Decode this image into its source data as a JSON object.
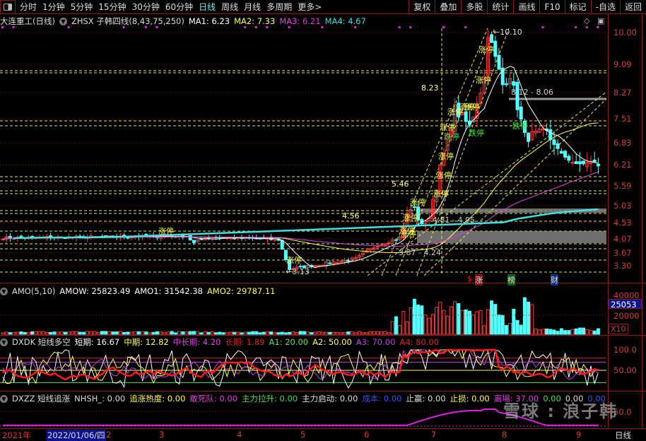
{
  "toolbar": {
    "periods": [
      "分时",
      "1分钟",
      "5分钟",
      "15分钟",
      "30分钟",
      "60分钟",
      "日线",
      "周线",
      "月线",
      "多周期",
      "更多>"
    ],
    "active_period": "日线",
    "buttons": [
      "复权",
      "叠加",
      "多股",
      "统计",
      "画线",
      "F10",
      "标记",
      "-自选",
      "返回"
    ]
  },
  "main": {
    "stock": "大连重工(日线)",
    "indicator": "ZHSX 子韩四线(8,43,75,250)",
    "ma1": "MA1: 6.23",
    "ma2": "MA2: 7.33",
    "ma3": "MA3: 6.21",
    "ma4": "MA4: 4.67",
    "price_ticks": [
      "10.00",
      "9.09",
      "8.27",
      "7.51",
      "6.83",
      "6.21",
      "5.59",
      "5.03",
      "4.53",
      "4.07",
      "3.67",
      "3.30"
    ],
    "annotations": {
      "high": "10.10",
      "low": "3.13",
      "l823": "8.23",
      "l546": "5.46",
      "l456": "4.56",
      "r812": "8.12 - 8.06",
      "r481": "4.81 - 4.95",
      "r387": "3.87 - 4.24",
      "limit_up": "涨停",
      "limit_down": "跌停",
      "m1": "$",
      "m2": "涨",
      "m3": "榜",
      "m4": "财"
    }
  },
  "amo": {
    "title": "AMO(5,10)",
    "amow": "AMOW: 25823.49",
    "amo1": "AMO1: 31542.38",
    "amo2": "AMO2: 29787.11",
    "ticks": [
      "40000",
      "20000"
    ],
    "current": "25053",
    "scale": "X10"
  },
  "dxdk": {
    "title": "DXDK 短线多空",
    "short": "短期: 16.67",
    "mid": "中期: 12.82",
    "midlong": "中长期: 4.20",
    "long": "长期: 1.89",
    "a1": "A1: 20.00",
    "a2": "A2: 50.00",
    "a3": "A3: 70.00",
    "a4": "A4: 80.00",
    "ticks": [
      "100.0",
      "50.00"
    ]
  },
  "dxzz": {
    "title": "DXZZ 短线追涨",
    "items": [
      "NHSH_: 0.00",
      "追涨热度: 0.00",
      "敢死队: 0.00",
      "主力拉升: 0.00",
      "主力启动: 0.00",
      "成本: 0.00",
      "止赢: 0.00",
      "止损: 0.00",
      "离場: 37.00",
      "0.00",
      "0.00",
      "0.00"
    ],
    "tick": "50.0"
  },
  "timeaxis": {
    "year": "2021年",
    "cursor": "2022/01/06/四",
    "months": [
      "1",
      "2",
      "3",
      "4",
      "5",
      "6",
      "7",
      "8",
      "9"
    ],
    "period": "日线"
  },
  "watermark": "雪球 : 浪子韩",
  "colors": {
    "up": "#ff3b3b",
    "down": "#54ffff",
    "ma1": "#ffffff",
    "ma2": "#ffff55",
    "ma3": "#e040e0",
    "ma4": "#40e0e0",
    "axis": "#d83c3c"
  },
  "chart_data": {
    "type": "candlestick",
    "price_keypoints": [
      [
        0,
        4.1
      ],
      [
        50,
        4.15
      ],
      [
        52,
        3.95
      ],
      [
        55,
        4.12
      ],
      [
        75,
        4.05
      ],
      [
        78,
        3.2
      ],
      [
        87,
        3.35
      ],
      [
        96,
        3.5
      ],
      [
        102,
        3.9
      ],
      [
        108,
        4.1
      ],
      [
        111,
        5.0
      ],
      [
        115,
        4.4
      ],
      [
        117,
        5.2
      ],
      [
        120,
        6.5
      ],
      [
        123,
        7.8
      ],
      [
        127,
        7.3
      ],
      [
        131,
        8.7
      ],
      [
        132,
        10.0
      ],
      [
        136,
        8.5
      ],
      [
        138,
        8.8
      ],
      [
        142,
        7.0
      ],
      [
        148,
        7.1
      ],
      [
        152,
        6.5
      ],
      [
        156,
        6.2
      ],
      [
        161,
        6.3
      ],
      [
        162,
        6.15
      ]
    ]
  }
}
